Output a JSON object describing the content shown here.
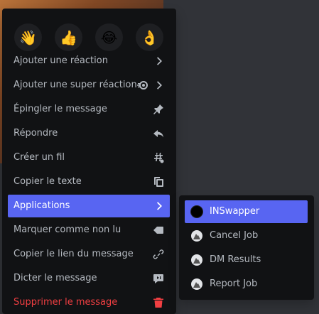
{
  "emoji_reactions": [
    {
      "glyph": "👋",
      "icon": "waving-hand-icon"
    },
    {
      "glyph": "👍",
      "icon": "thumbs-up-icon"
    },
    {
      "glyph": "😂",
      "icon": "tears-of-joy-icon"
    },
    {
      "glyph": "👌",
      "icon": "ok-hand-icon"
    }
  ],
  "menu": {
    "items": [
      {
        "label": "Ajouter une réaction",
        "icon": "chevron-right-icon"
      },
      {
        "label": "Ajouter une super réaction",
        "icon": "super-reaction-icon"
      },
      {
        "label": "Épingler le message",
        "icon": "pin-icon"
      },
      {
        "label": "Répondre",
        "icon": "reply-icon"
      },
      {
        "label": "Créer un fil",
        "icon": "thread-icon"
      },
      {
        "label": "Copier le texte",
        "icon": "copy-icon"
      },
      {
        "label": "Applications",
        "icon": "chevron-right-icon",
        "active": true
      },
      {
        "label": "Marquer comme non lu",
        "icon": "mark-unread-icon"
      },
      {
        "label": "Copier le lien du message",
        "icon": "link-icon"
      },
      {
        "label": "Dicter le message",
        "icon": "speak-message-icon"
      },
      {
        "label": "Supprimer le message",
        "icon": "trash-icon",
        "danger": true
      }
    ]
  },
  "applications_submenu": {
    "items": [
      {
        "label": "INSwapper",
        "icon": "inswapper-app-icon",
        "active": true
      },
      {
        "label": "Cancel Job",
        "icon": "bot-app-icon"
      },
      {
        "label": "DM Results",
        "icon": "bot-app-icon"
      },
      {
        "label": "Report Job",
        "icon": "bot-app-icon"
      }
    ]
  },
  "colors": {
    "menu_bg": "#111214",
    "text": "#b5bac1",
    "accent": "#5865f2",
    "danger": "#f23f42"
  }
}
